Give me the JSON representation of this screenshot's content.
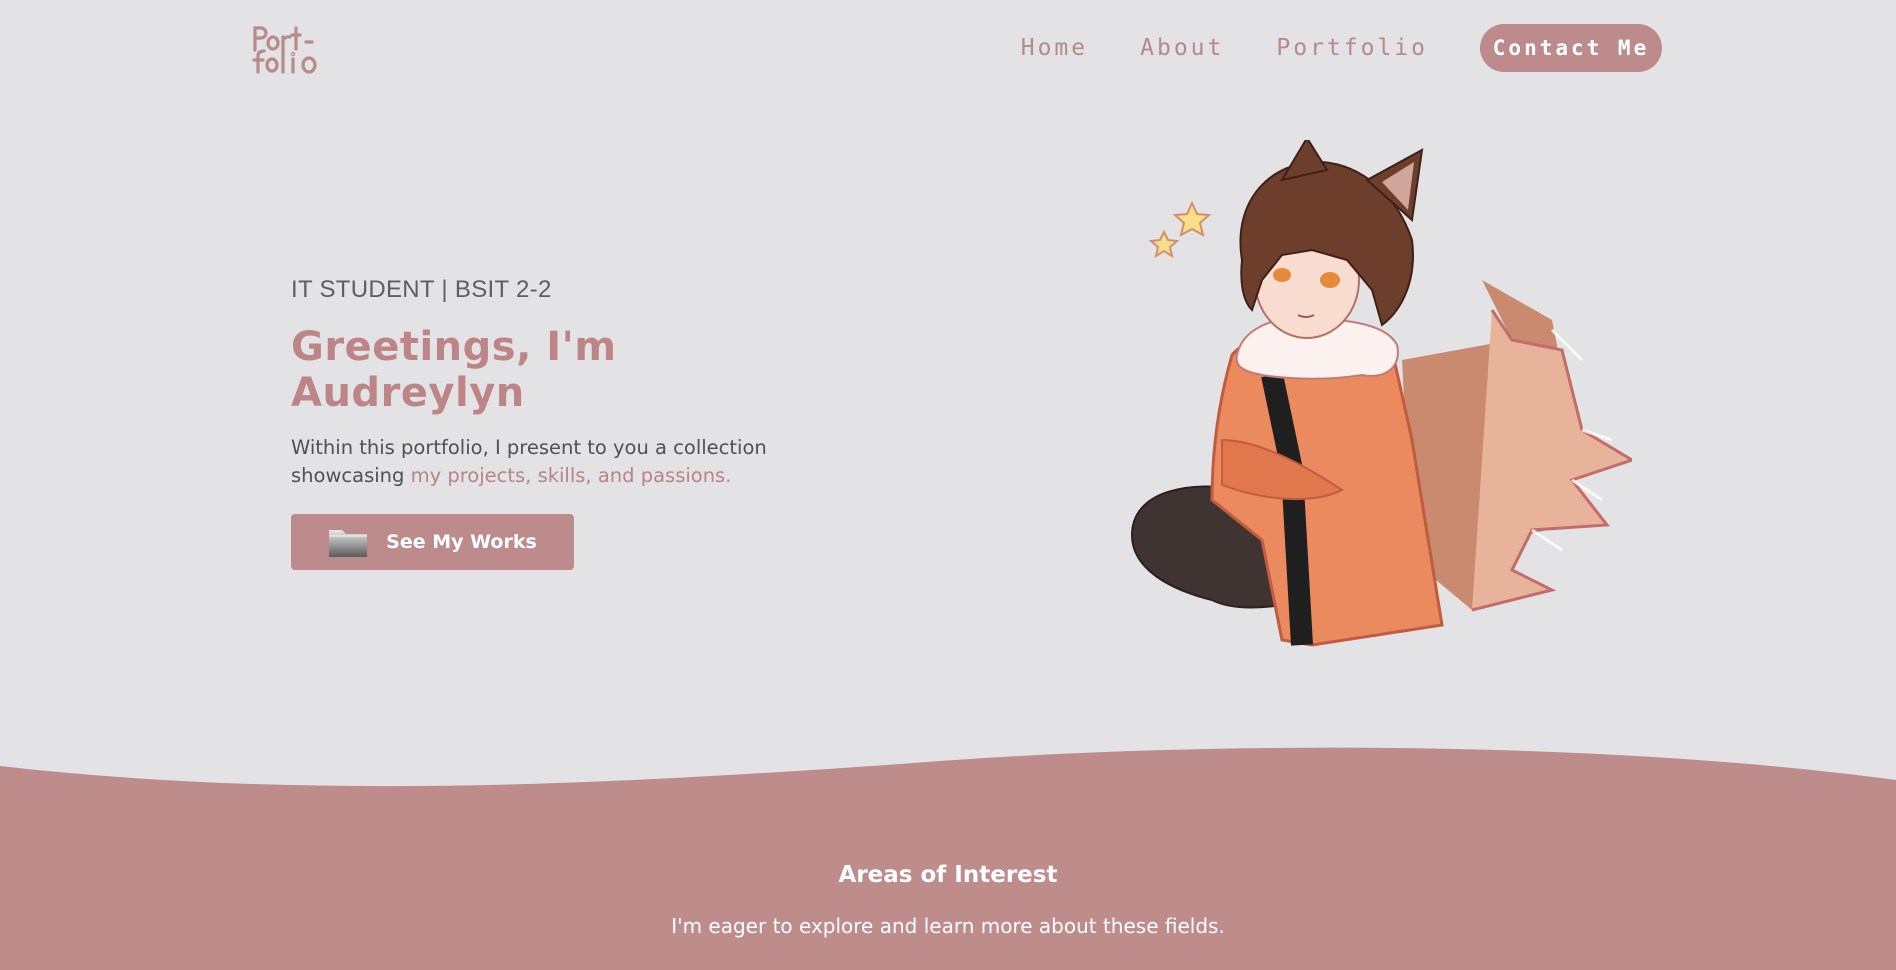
{
  "brand": {
    "logo_text": "Portfolio",
    "accent_color": "#bd8b8b",
    "background_color": "#e3e3e5"
  },
  "nav": {
    "items": [
      {
        "label": "Home"
      },
      {
        "label": "About"
      },
      {
        "label": "Portfolio"
      }
    ],
    "contact_label": "Contact Me"
  },
  "hero": {
    "subtitle": "IT STUDENT | BSIT 2-2",
    "title": "Greetings, I'm Audreylyn",
    "description_plain": "Within this portfolio, I present to you a collection showcasing ",
    "description_accent": "my projects, skills, and passions.",
    "button_icon": "folder-icon",
    "button_label": "See My Works",
    "illustration": "fox-character-illustration"
  },
  "interests": {
    "title": "Areas of Interest",
    "subtitle": "I'm eager to explore and learn more about these fields."
  }
}
